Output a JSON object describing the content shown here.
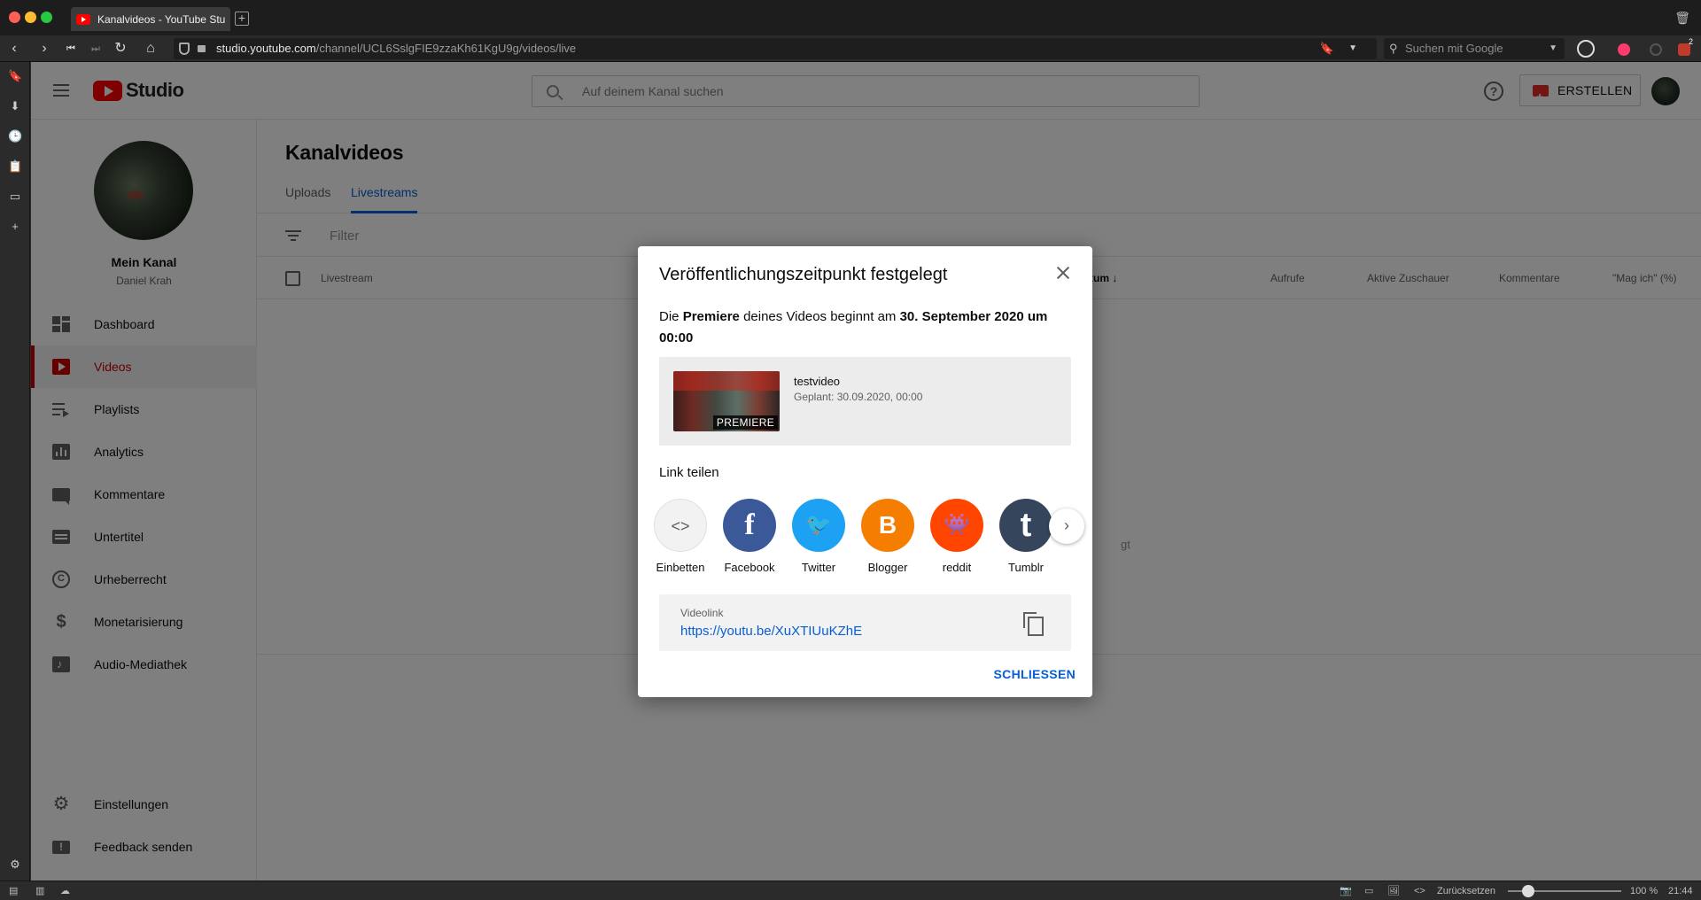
{
  "browser": {
    "tab_title": "Kanalvideos - YouTube Stu",
    "url_host": "studio.youtube.com",
    "url_path": "/channel/UCL6SslgFIE9zzaKh61KgU9g/videos/live",
    "search_placeholder": "Suchen mit Google",
    "extension_badge": "2",
    "status": {
      "reset_label": "Zurücksetzen",
      "zoom": "100 %",
      "clock": "21:44"
    }
  },
  "header": {
    "logo_text": "Studio",
    "search_placeholder": "Auf deinem Kanal suchen",
    "create_label": "ERSTELLEN",
    "help_glyph": "?"
  },
  "sidebar": {
    "channel_label": "Mein Kanal",
    "owner": "Daniel Krah",
    "items": [
      {
        "label": "Dashboard",
        "icon": "dashboard-icon"
      },
      {
        "label": "Videos",
        "icon": "videos-icon",
        "active": true
      },
      {
        "label": "Playlists",
        "icon": "playlists-icon"
      },
      {
        "label": "Analytics",
        "icon": "analytics-icon"
      },
      {
        "label": "Kommentare",
        "icon": "comments-icon"
      },
      {
        "label": "Untertitel",
        "icon": "subtitles-icon"
      },
      {
        "label": "Urheberrecht",
        "icon": "copyright-icon"
      },
      {
        "label": "Monetarisierung",
        "icon": "dollar-icon"
      },
      {
        "label": "Audio-Mediathek",
        "icon": "audio-library-icon"
      }
    ],
    "bottom": [
      {
        "label": "Einstellungen",
        "icon": "gear-icon"
      },
      {
        "label": "Feedback senden",
        "icon": "feedback-icon"
      }
    ]
  },
  "main": {
    "title": "Kanalvideos",
    "tabs": [
      {
        "label": "Uploads"
      },
      {
        "label": "Livestreams",
        "active": true
      }
    ],
    "filter_placeholder": "Filter",
    "columns": [
      "Livestream",
      "tum",
      "Aufrufe",
      "Aktive Zuschauer",
      "Kommentare",
      "\"Mag ich\" (%)"
    ],
    "empty_hint_fragment": "gt"
  },
  "dialog": {
    "title": "Veröffentlichungszeitpunkt festgelegt",
    "message_prefix": "Die ",
    "message_bold1": "Premiere",
    "message_mid": " deines Videos beginnt am ",
    "message_bold2": "30. September 2020 um 00:00",
    "video": {
      "title": "testvideo",
      "scheduled": "Geplant: 30.09.2020, 00:00",
      "badge": "PREMIERE"
    },
    "share_label": "Link teilen",
    "share_targets": [
      {
        "label": "Einbetten",
        "glyph": "<>",
        "color": "#f2f2f2"
      },
      {
        "label": "Facebook",
        "glyph": "f",
        "color": "#3b5998"
      },
      {
        "label": "Twitter",
        "glyph": "🐦",
        "color": "#1da1f2"
      },
      {
        "label": "Blogger",
        "glyph": "B",
        "color": "#f57d00"
      },
      {
        "label": "reddit",
        "glyph": "👾",
        "color": "#ff4500"
      },
      {
        "label": "Tumblr",
        "glyph": "t",
        "color": "#35465c"
      }
    ],
    "link_label": "Videolink",
    "link_url": "https://youtu.be/XuXTIUuKZhE",
    "close_label": "SCHLIESSEN"
  }
}
